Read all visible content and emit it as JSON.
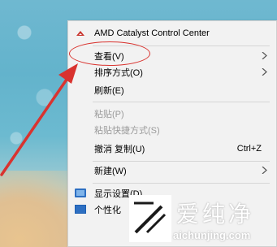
{
  "menu": {
    "items": [
      {
        "label": "AMD Catalyst Control Center",
        "icon": "amd-icon"
      },
      {
        "label": "查看(V)",
        "submenu": true
      },
      {
        "label": "排序方式(O)",
        "submenu": true
      },
      {
        "label": "刷新(E)"
      },
      {
        "label": "粘贴(P)",
        "disabled": true
      },
      {
        "label": "粘贴快捷方式(S)",
        "disabled": true
      },
      {
        "label": "撤消 复制(U)",
        "shortcut": "Ctrl+Z"
      },
      {
        "label": "新建(W)",
        "submenu": true
      },
      {
        "label": "显示设置(D)",
        "icon": "display-icon"
      },
      {
        "label": "个性化",
        "icon": "personalize-icon"
      }
    ]
  },
  "watermark": {
    "title": "爱纯净",
    "url": "aichunjing.com"
  },
  "colors": {
    "menu_bg": "#f2f2f2",
    "annotation_red": "#d9332f",
    "disabled_text": "#9a9a9a"
  }
}
